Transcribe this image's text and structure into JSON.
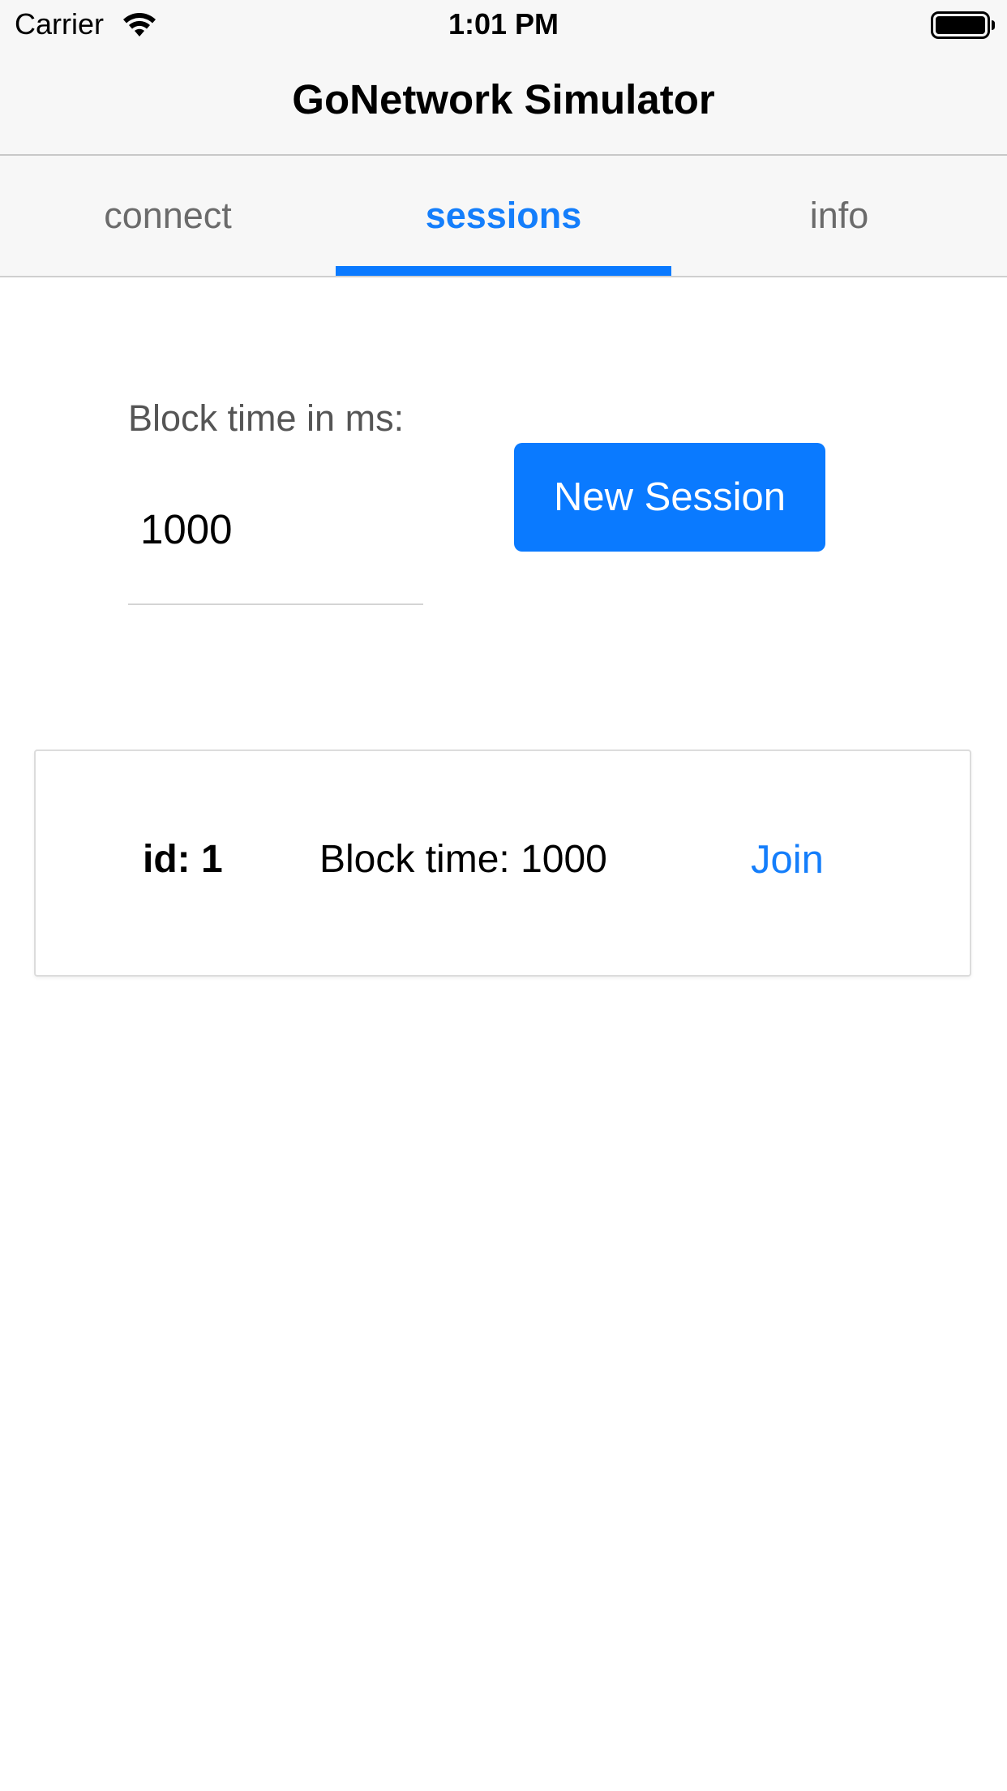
{
  "status_bar": {
    "carrier": "Carrier",
    "time": "1:01 PM"
  },
  "nav": {
    "title": "GoNetwork Simulator"
  },
  "tabs": [
    {
      "label": "connect",
      "active": false
    },
    {
      "label": "sessions",
      "active": true
    },
    {
      "label": "info",
      "active": false
    }
  ],
  "form": {
    "block_time_label": "Block time in ms:",
    "block_time_value": "1000",
    "new_session_label": "New Session"
  },
  "sessions": [
    {
      "id_text": "id: 1",
      "block_time_text": "Block time: 1000",
      "join_label": "Join"
    }
  ],
  "colors": {
    "accent": "#0a7aff",
    "tab_active": "#147efb",
    "tab_inactive": "#6b6b6b",
    "header_background": "#f7f7f7"
  },
  "icons": {
    "wifi": "wifi-icon",
    "battery": "battery-icon"
  }
}
